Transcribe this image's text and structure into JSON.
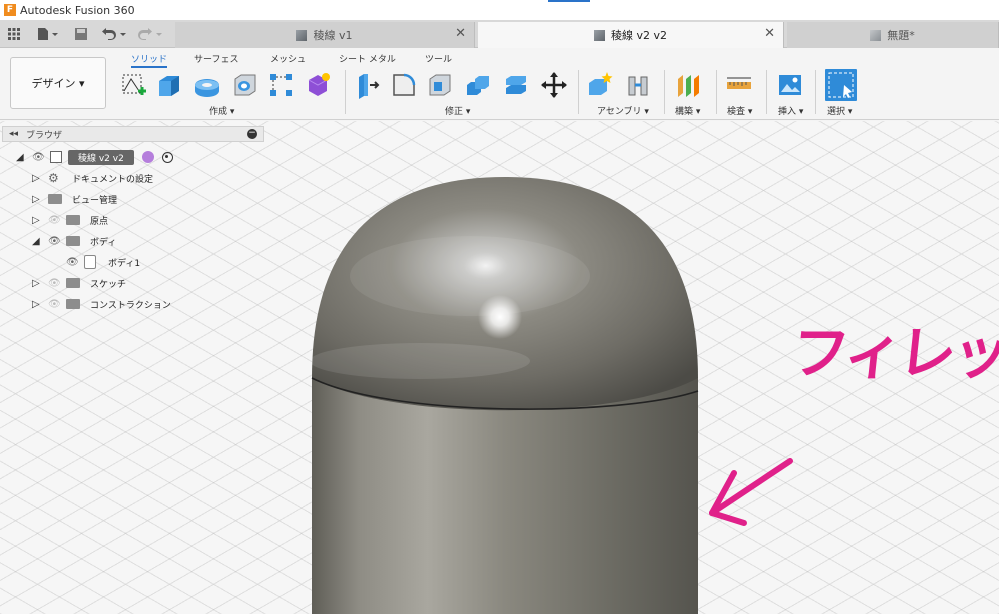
{
  "app": {
    "title": "Autodesk Fusion 360",
    "logo_letter": "F"
  },
  "tabs": [
    {
      "label": "稜線 v1",
      "active": false
    },
    {
      "label": "稜線 v2 v2",
      "active": true
    },
    {
      "label": "無題*",
      "active": false
    }
  ],
  "toolbar": {
    "workspace": "デザイン ▾",
    "ribbon_tabs": [
      "ソリッド",
      "サーフェス",
      "メッシュ",
      "シート メタル",
      "ツール"
    ],
    "groups": {
      "create": "作成 ▾",
      "modify": "修正 ▾",
      "assemble": "アセンブリ ▾",
      "construct": "構築 ▾",
      "inspect": "検査 ▾",
      "insert": "挿入 ▾",
      "select": "選択 ▾"
    }
  },
  "browser": {
    "title": "ブラウザ",
    "root": "稜線 v2 v2",
    "items": [
      "ドキュメントの設定",
      "ビュー管理",
      "原点",
      "ボディ",
      "ボディ1",
      "スケッチ",
      "コンストラクション"
    ]
  },
  "annotation": {
    "text": "フィレット",
    "color": "#e0218a"
  },
  "colors": {
    "accent": "#2a73c9",
    "annotation": "#e0218a"
  }
}
